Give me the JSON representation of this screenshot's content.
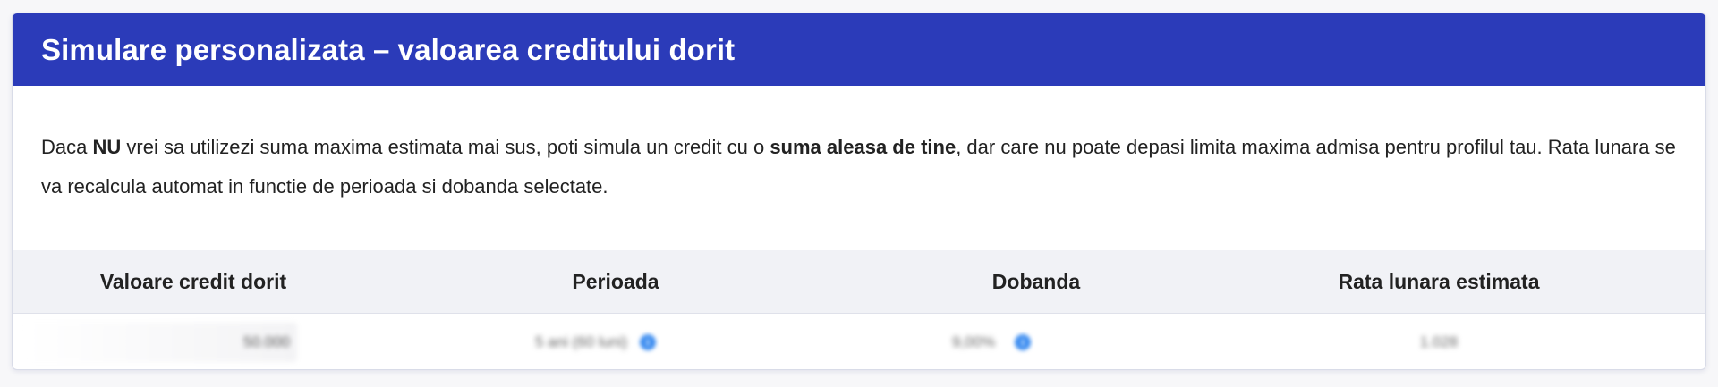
{
  "card": {
    "title": "Simulare personalizata – valoarea creditului dorit",
    "intro": {
      "p1": "Daca ",
      "b1": "NU",
      "p2": " vrei sa utilizezi suma maxima estimata mai sus, poti simula un credit cu o ",
      "b2": "suma aleasa de tine",
      "p3": ", dar care nu poate depasi limita maxima admisa pentru profilul tau. Rata lunara se va recalcula automat in functie de perioada si dobanda selectate."
    }
  },
  "table": {
    "headers": [
      "Valoare credit dorit",
      "Perioada",
      "Dobanda",
      "Rata lunara estimata"
    ],
    "row": {
      "amount": "50.000",
      "period": "5 ani (60 luni)",
      "rate": "9,00%",
      "monthly": "1.028"
    }
  },
  "colors": {
    "header_bg": "#2b3bb9",
    "info_icon": "#3b8cf0"
  },
  "icons": {
    "period_info": "info-icon",
    "rate_info": "info-icon"
  }
}
